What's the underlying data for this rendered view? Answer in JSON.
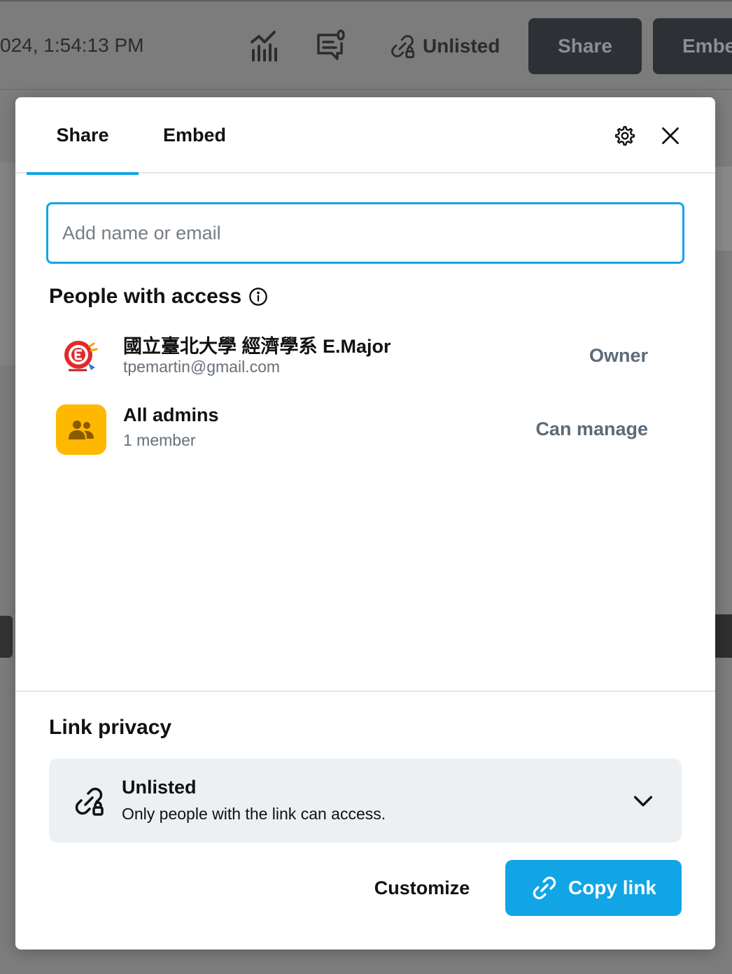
{
  "background": {
    "timestamp": "024, 1:54:13 PM",
    "unlisted_label": "Unlisted",
    "share_button": "Share",
    "embed_button": "Embe"
  },
  "modal": {
    "tabs": [
      {
        "label": "Share",
        "active": true
      },
      {
        "label": "Embed",
        "active": false
      }
    ],
    "search": {
      "placeholder": "Add name or email",
      "value": ""
    },
    "people_title": "People with access",
    "people": [
      {
        "name": "國立臺北大學 經濟學系 E.Major",
        "sub": "tpemartin@gmail.com",
        "role": "Owner",
        "avatar": "logo"
      },
      {
        "name": "All admins",
        "sub": "1 member",
        "role": "Can manage",
        "avatar": "group-icon"
      }
    ],
    "link_privacy": {
      "title": "Link privacy",
      "option_title": "Unlisted",
      "option_desc": "Only people with the link can access."
    },
    "actions": {
      "customize": "Customize",
      "copy_link": "Copy link"
    }
  },
  "colors": {
    "accent": "#12a5e6",
    "group_avatar": "#ffb800",
    "muted_text": "#66707a"
  }
}
